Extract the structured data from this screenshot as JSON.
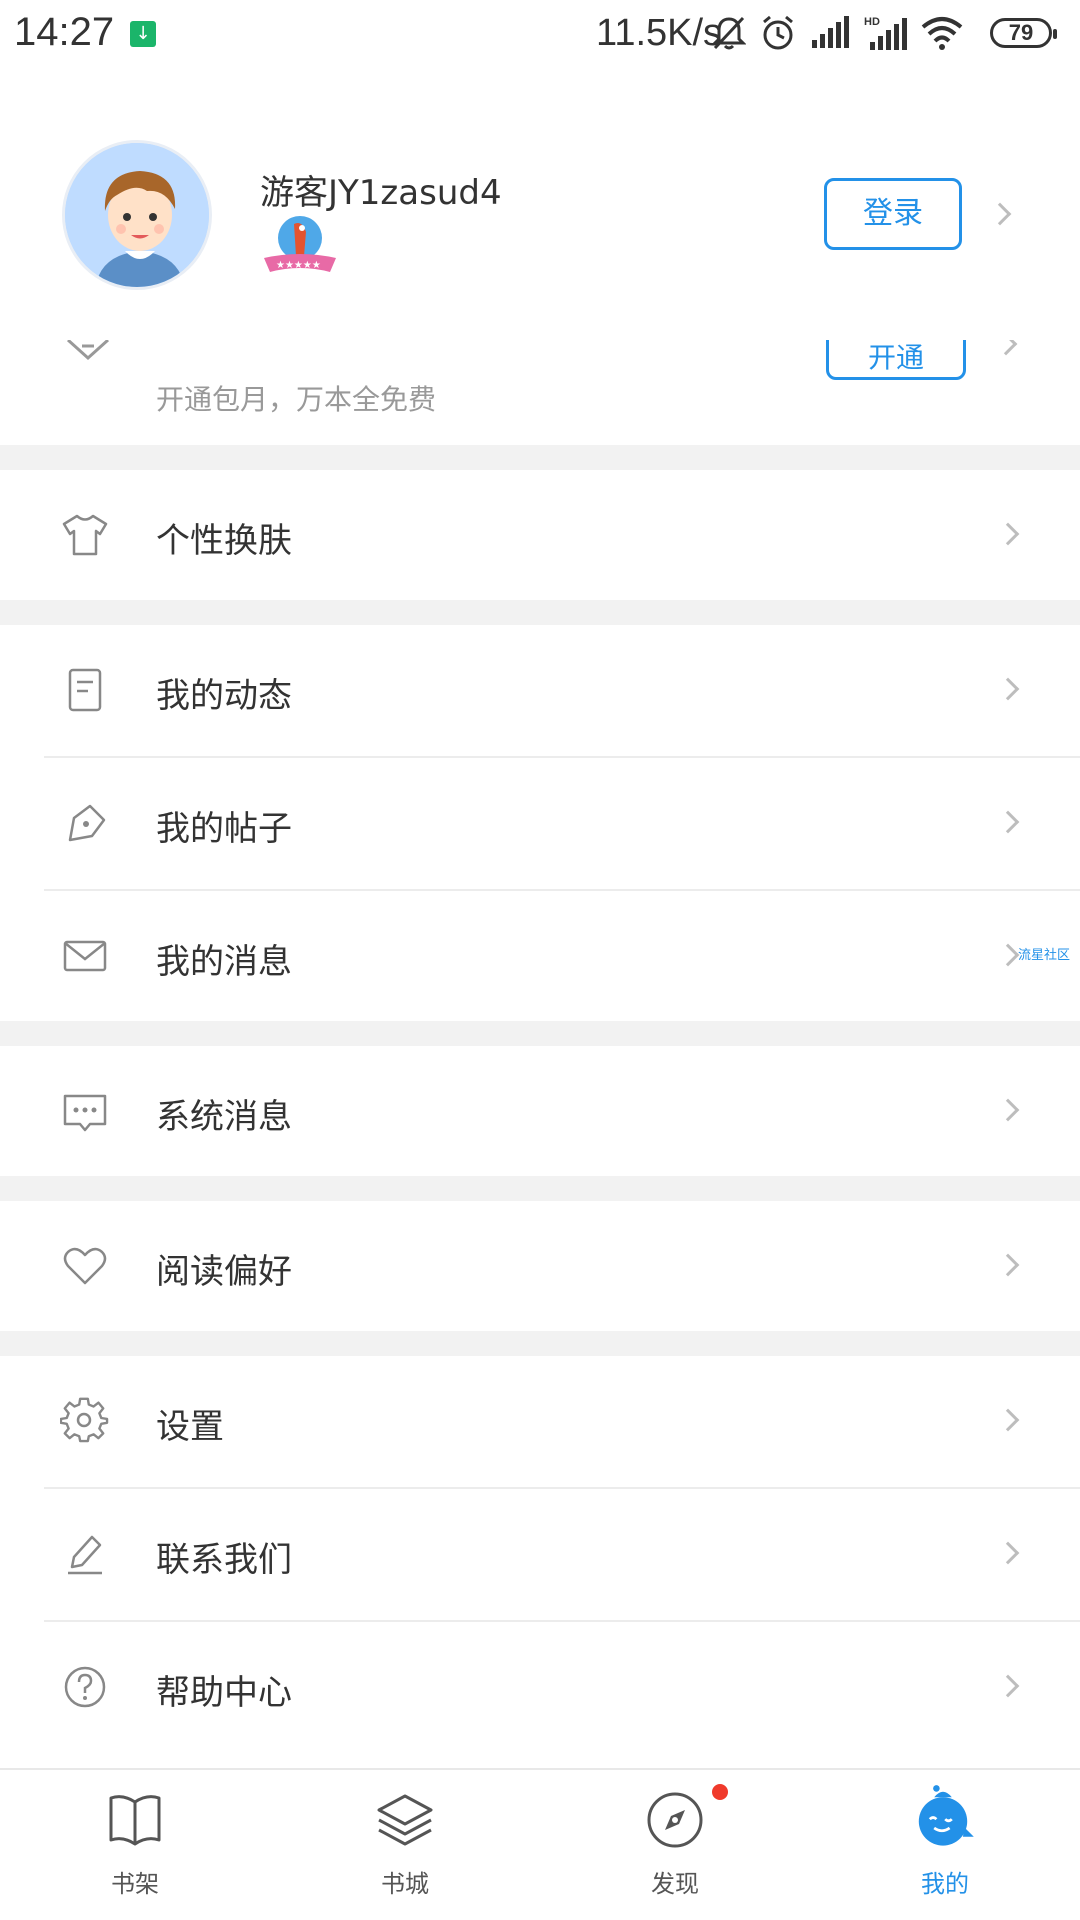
{
  "status_bar": {
    "time": "14:27",
    "net_speed": "11.5K/s",
    "battery": "79",
    "icons": [
      "download-icon",
      "bell-mute-icon",
      "alarm-icon",
      "signal-icon",
      "signal-hd-icon",
      "wifi-icon",
      "battery-icon"
    ]
  },
  "profile": {
    "username": "游客JY1zasud4",
    "login_label": "登录"
  },
  "vip": {
    "subtitle": "开通包月，万本全免费",
    "button_label": "开通"
  },
  "menu": {
    "skin": "个性换肤",
    "dynamics": "我的动态",
    "posts": "我的帖子",
    "messages": "我的消息",
    "system_messages": "系统消息",
    "reading_pref": "阅读偏好",
    "settings": "设置",
    "contact": "联系我们",
    "help": "帮助中心"
  },
  "side_tag": "流星社区",
  "tabs": [
    {
      "label": "书架"
    },
    {
      "label": "书城"
    },
    {
      "label": "发现"
    },
    {
      "label": "我的"
    }
  ],
  "colors": {
    "accent": "#2391e8",
    "separator": "#f2f2f2",
    "badge_dot": "#f03a2b"
  }
}
